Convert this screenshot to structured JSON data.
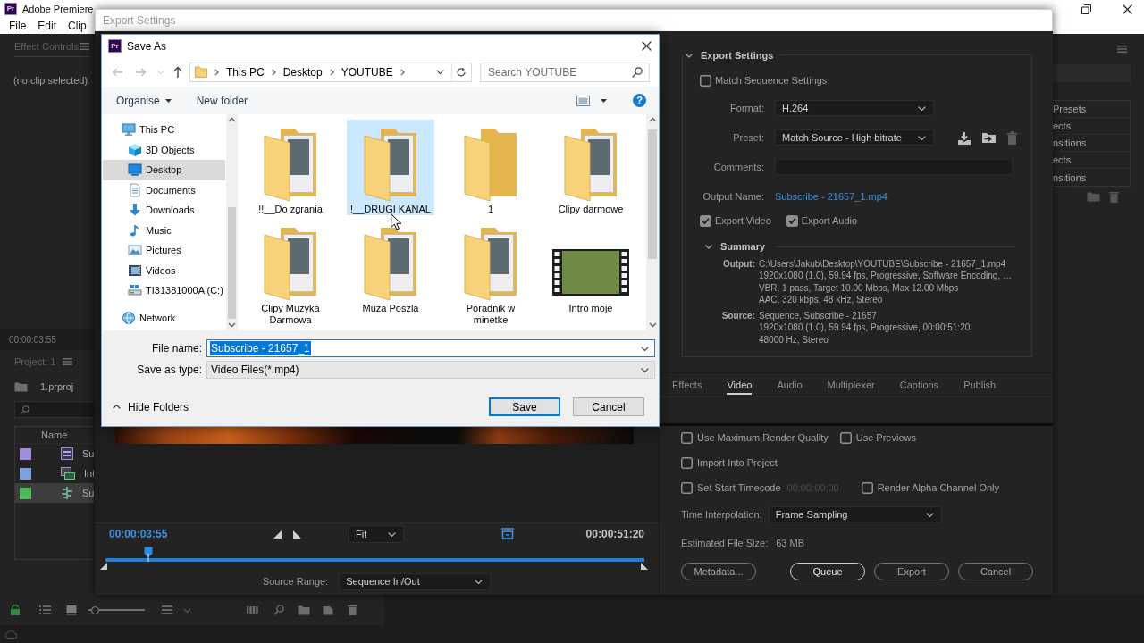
{
  "premiere": {
    "logo": "Pr",
    "title": "Adobe Premiere",
    "menu": [
      "File",
      "Edit",
      "Clip"
    ],
    "effect_controls": {
      "tab": "Effect Controls",
      "message": "(no clip selected)"
    },
    "timecode": "00:00:03:55",
    "project": {
      "tab": "Project: 1",
      "file": "1.prproj",
      "column": "Name",
      "rows": [
        {
          "name": "Su",
          "color": "#a08de0",
          "kind": "sequence",
          "selected": false
        },
        {
          "name": "Int",
          "color": "#7e9fe0",
          "kind": "clip",
          "selected": false
        },
        {
          "name": "Su",
          "color": "#4fb85a",
          "kind": "multicam",
          "selected": true
        }
      ]
    },
    "effects_list": [
      "Presets",
      "ects",
      "nsitions",
      "ects",
      "nsitions"
    ],
    "zoom_slider": {
      "level": 0.05
    }
  },
  "export_window": {
    "title": "Export Settings",
    "preview": {
      "timecode": "00:00:03:55",
      "zoom": "Fit",
      "duration": "00:00:51:20",
      "playhead": {
        "level": 0.08
      },
      "range_label": "Source Range:",
      "range": "Sequence In/Out"
    },
    "settings": {
      "heading": "Export Settings",
      "expanded": true,
      "match_sequence": {
        "label": "Match Sequence Settings",
        "checked": false
      },
      "format": {
        "label": "Format:",
        "value": "H.264"
      },
      "preset": {
        "label": "Preset:",
        "value": "Match Source - High bitrate"
      },
      "comments": {
        "label": "Comments:"
      },
      "output_name": {
        "label": "Output Name:",
        "value": "Subscribe - 21657_1.mp4"
      },
      "export_video": {
        "label": "Export Video",
        "checked": true
      },
      "export_audio": {
        "label": "Export Audio",
        "checked": true
      },
      "summary": {
        "heading": "Summary",
        "expanded": true,
        "groups": [
          {
            "label": "Output:",
            "lines": [
              "C:\\Users\\Jakub\\Desktop\\YOUTUBE\\Subscribe - 21657_1.mp4",
              "1920x1080 (1.0), 59.94 fps, Progressive, Software Encoding, …",
              "VBR, 1 pass, Target 10.00 Mbps, Max 12.00 Mbps",
              "AAC, 320 kbps, 48 kHz, Stereo"
            ]
          },
          {
            "label": "Source:",
            "lines": [
              "Sequence, Subscribe - 21657",
              "1920x1080 (1.0), 59.94 fps, Progressive, 00:00:51:20",
              "48000 Hz, Stereo"
            ]
          }
        ]
      }
    },
    "tabs": [
      {
        "label": "Effects",
        "selected": false
      },
      {
        "label": "Video",
        "selected": true
      },
      {
        "label": "Audio",
        "selected": false
      },
      {
        "label": "Multiplexer",
        "selected": false
      },
      {
        "label": "Captions",
        "selected": false
      },
      {
        "label": "Publish",
        "selected": false
      }
    ],
    "option_rows": [
      {
        "options": [
          {
            "label": "Use Maximum Render Quality",
            "checked": false
          },
          {
            "label": "Use Previews",
            "checked": false
          }
        ]
      },
      {
        "options": [
          {
            "label": "Import Into Project",
            "checked": false
          }
        ]
      },
      {
        "options": [
          {
            "label": "Set Start Timecode",
            "checked": false,
            "timecode": {
              "value": "00:00:00:00",
              "disabled": true
            }
          },
          {
            "label": "Render Alpha Channel Only",
            "checked": false
          }
        ]
      }
    ],
    "time_interpolation": {
      "label": "Time Interpolation:",
      "value": "Frame Sampling"
    },
    "file_size": {
      "label": "Estimated File Size:",
      "value": "63 MB"
    },
    "metadata_button": "Metadata...",
    "buttons": [
      {
        "label": "Queue",
        "focused": true
      },
      {
        "label": "Export",
        "focused": false
      },
      {
        "label": "Cancel",
        "focused": false
      }
    ]
  },
  "save_as": {
    "logo": "Pr",
    "title": "Save As",
    "path": [
      "This PC",
      "Desktop",
      "YOUTUBE"
    ],
    "search": {
      "placeholder": "Search YOUTUBE"
    },
    "organise": "Organise",
    "new_folder": "New folder",
    "help": "?",
    "tree": [
      {
        "label": "This PC",
        "kind": "computer",
        "selected": false,
        "children": [
          {
            "label": "3D Objects",
            "kind": "cube",
            "selected": false
          },
          {
            "label": "Desktop",
            "kind": "desktop",
            "selected": true
          },
          {
            "label": "Documents",
            "kind": "documents",
            "selected": false
          },
          {
            "label": "Downloads",
            "kind": "downloads",
            "selected": false
          },
          {
            "label": "Music",
            "kind": "music",
            "selected": false
          },
          {
            "label": "Pictures",
            "kind": "pictures",
            "selected": false
          },
          {
            "label": "Videos",
            "kind": "videos",
            "selected": false
          },
          {
            "label": "TI31381000A (C:)",
            "kind": "drive",
            "selected": false
          }
        ]
      },
      {
        "label": "Network",
        "kind": "network",
        "selected": false
      }
    ],
    "files": [
      {
        "name": "!!__Do zgrania",
        "kind": "filled-folder",
        "selected": false
      },
      {
        "name": "!__DRUGI KANAL",
        "kind": "filled-folder",
        "selected": true
      },
      {
        "name": "1",
        "kind": "folder",
        "selected": false
      },
      {
        "name": "Clipy darmowe",
        "kind": "filled-folder",
        "selected": false
      },
      {
        "name": "Clipy Muzyka Darmowa",
        "kind": "filled-folder",
        "selected": false
      },
      {
        "name": "Muza Poszla",
        "kind": "filled-folder",
        "selected": false
      },
      {
        "name": "Poradnik w minetke",
        "kind": "filled-folder",
        "selected": false
      },
      {
        "name": "Intro moje",
        "kind": "video",
        "selected": false
      }
    ],
    "file_name": {
      "label": "File name:",
      "value": "Subscribe - 21657_1",
      "text_selected": true
    },
    "file_type": {
      "label": "Save as type:",
      "value": "Video Files(*.mp4)"
    },
    "hide_folders": "Hide Folders",
    "buttons": [
      {
        "label": "Save",
        "default": true
      },
      {
        "label": "Cancel",
        "default": false
      }
    ]
  }
}
